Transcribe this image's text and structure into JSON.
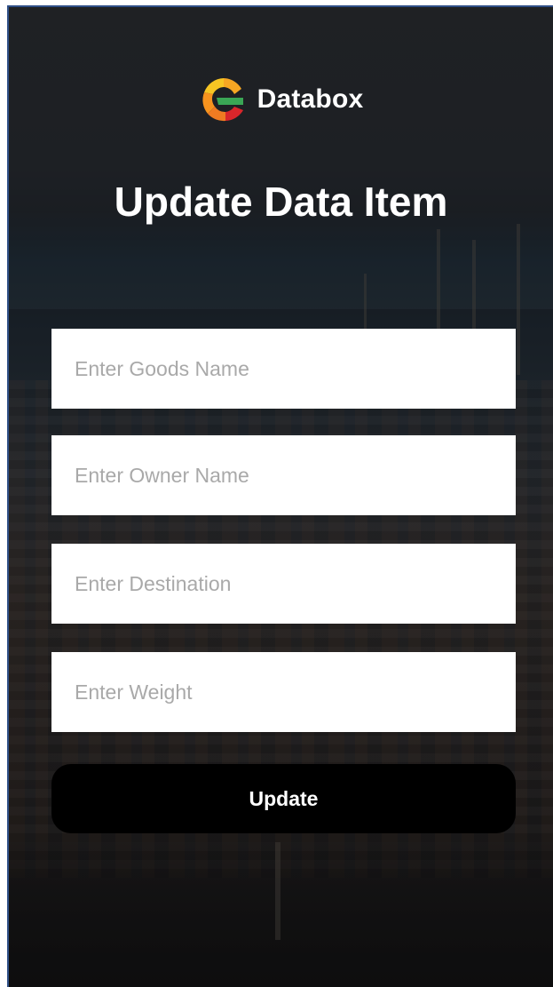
{
  "header": {
    "brand_name": "Databox",
    "logo_icon": "databox-logo-icon",
    "page_title": "Update Data Item"
  },
  "form": {
    "goods_name": {
      "value": "",
      "placeholder": "Enter Goods Name"
    },
    "owner_name": {
      "value": "",
      "placeholder": "Enter Owner Name"
    },
    "destination": {
      "value": "",
      "placeholder": "Enter Destination"
    },
    "weight": {
      "value": "",
      "placeholder": "Enter Weight"
    },
    "submit_label": "Update"
  },
  "colors": {
    "button_bg": "#000000",
    "field_bg": "#ffffff",
    "placeholder": "#a9a9a9",
    "logo_orange": "#f7931e",
    "logo_yellow": "#f6c523",
    "logo_green": "#3aa655",
    "logo_red": "#d9262b"
  }
}
